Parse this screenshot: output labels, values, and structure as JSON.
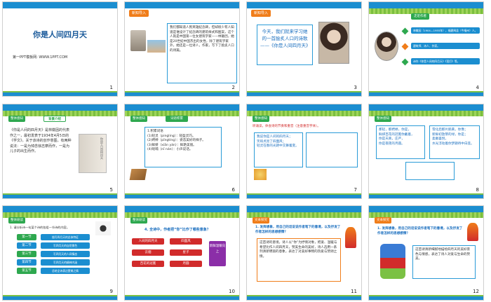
{
  "slides": [
    {
      "num": "1",
      "title": "你是人间四月天",
      "sub": "第一PPT模板网: WWW.1PPT.COM"
    },
    {
      "num": "2",
      "tag": "新知导入",
      "text": "我们都知道人民英雄纪念碑，但却很少有人知道是谁设计了纪念碑的建筑样式和图案，这个人就是中国第一位女建筑学家——林徽因，她是20世纪中国杰出的女性，除了建筑学家外，她还是一位诗人，作家，写下了脍炙人口的诗篇。"
    },
    {
      "num": "3",
      "tag": "新知导入",
      "text": "今天，我们就来学习她的一首脍炙人口的诗歌——《你是人间四月天》"
    },
    {
      "num": "4",
      "tag": "走近作者",
      "items": [
        "林徽因（1904—1955年），福建闽县（今福州）人。",
        "建筑师、诗人、作家。",
        "诗作《你是人间的四月天》《莲灯》等。"
      ],
      "badges": [
        "作品",
        "成就"
      ]
    },
    {
      "num": "5",
      "tag": "整体感知",
      "heading": "背景介绍",
      "text": "《你是人间的四月天》是林徽因的代表作之一，最初发表于1934年4月5日的《学文》。关于该诗的创作意图，有两种说法：一是为悼念徐志摩而作，一是为儿子的出生而作。",
      "book": "你是人间四月天"
    },
    {
      "num": "6",
      "tag": "整体感知",
      "heading": "词语积累",
      "words": [
        "1.积累词语",
        "(1)轻灵（pingling）：轻盈灵巧。",
        "(2)娉婷（pīngtíng）：姿态美好的样子。",
        "(3)鲜妍（xiān yán）：鲜艳美丽。",
        "(4)呢喃（nī nán）：小声说话。"
      ]
    },
    {
      "num": "7",
      "tag": "整体感知",
      "heading": "听诵读，体会诗的节奏和重音（注意重音字体）。",
      "poem": [
        "我说你是人间的四月天；",
        "笑响点亮了四面风；",
        "轻灵在春的光艳中交舞着变。"
      ]
    },
    {
      "num": "8",
      "tag": "整体感知",
      "lines": [
        "那轻，那娉婷，你是，",
        "鲜妍百花的冠冕你戴着，",
        "你是天真，庄严，",
        "你是夜夜的月圆。"
      ],
      "right": [
        "雪化后那片鹅黄，你像；",
        "新鲜初放芽的绿，你是；",
        "柔嫩喜悦，",
        "水光浮动着你梦期待中白莲。"
      ]
    },
    {
      "num": "9",
      "tag": "整体研读",
      "question": "1. 请分析诗一句某个诗的各组一节诗的内容。",
      "sections": [
        "第一节",
        "第二节",
        "第三节",
        "第四节",
        "第五节"
      ],
      "notes": [
        "描写四月天的总体特征",
        "写四月天的自然景色",
        "写四月天的人间情态",
        "写四月天的精神内涵",
        "总结全诗表达赞美之情"
      ]
    },
    {
      "num": "10",
      "tag": "整体研读",
      "question": "4. 全诗中，作者把“你”比作了哪些意象？",
      "items": [
        "人间的四月天",
        "四面风",
        "云烟",
        "星子",
        "百花的冠冕",
        "月圆"
      ],
      "side": "新鲜温暖向上"
    },
    {
      "num": "11",
      "tag": "文本探究",
      "question": "1. 发挥想象，用自己的话说说作者笔下的意境，以及抒发了作者怎样的思想感情？",
      "text": "这首诗的意境，诗人以“你”为抒情对象，把爱、温暖与希望比作人间四月天，赞美生命的美好，诗人选用一系列清新明丽的意象，表达了对美好事物的热爱与赞颂之情。"
    },
    {
      "num": "12",
      "tag": "文本探究",
      "question": "1. 发挥想象，用自己的话说说作者笔下的意境，以及抒发了作者怎样的思想感情？",
      "text": "这首诗清新细腻地描绘四月天的美好景色与情感，表达了诗人对爱与生命的赞美。"
    }
  ],
  "colors": {
    "accent": "#1b8ed0",
    "green": "#2ea84f",
    "orange": "#f07d1a"
  }
}
